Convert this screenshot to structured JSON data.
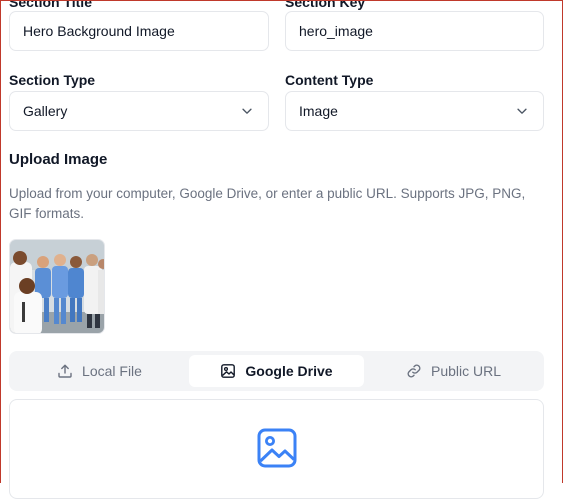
{
  "section_title": {
    "label": "Section Title",
    "value": "Hero Background Image"
  },
  "section_key": {
    "label": "Section Key",
    "value": "hero_image"
  },
  "section_type": {
    "label": "Section Type",
    "value": "Gallery"
  },
  "content_type": {
    "label": "Content Type",
    "value": "Image"
  },
  "upload": {
    "heading": "Upload Image",
    "helper": "Upload from your computer, Google Drive, or enter a public URL. Supports JPG, PNG, GIF formats."
  },
  "tabs": [
    {
      "label": "Local File",
      "icon": "upload-icon",
      "active": false
    },
    {
      "label": "Google Drive",
      "icon": "image-icon",
      "active": true
    },
    {
      "label": "Public URL",
      "icon": "link-icon",
      "active": false
    }
  ],
  "colors": {
    "accent": "#3b82f6",
    "frame": "#c0392b"
  }
}
